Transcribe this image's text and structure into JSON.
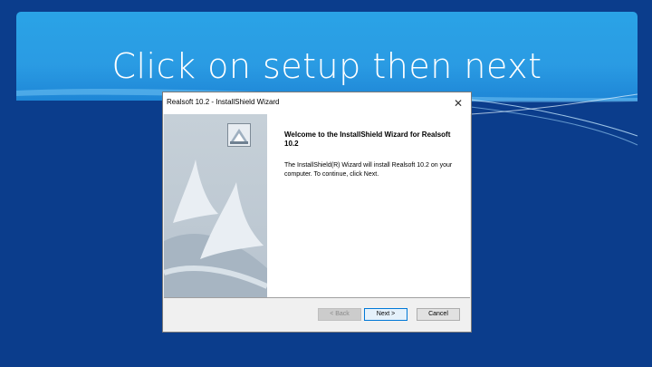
{
  "slide": {
    "title": "Click on setup then next",
    "colors": {
      "background": "#0b3d8c",
      "banner": "#2aa3e6"
    }
  },
  "dialog": {
    "title": "Realsoft 10.2 - InstallShield Wizard",
    "close_icon": "close-icon",
    "welcome_heading": "Welcome to the InstallShield Wizard for Realsoft 10.2",
    "description": "The InstallShield(R) Wizard will install Realsoft 10.2 on your computer. To continue, click Next.",
    "buttons": {
      "back": "< Back",
      "next": "Next >",
      "cancel": "Cancel"
    }
  }
}
